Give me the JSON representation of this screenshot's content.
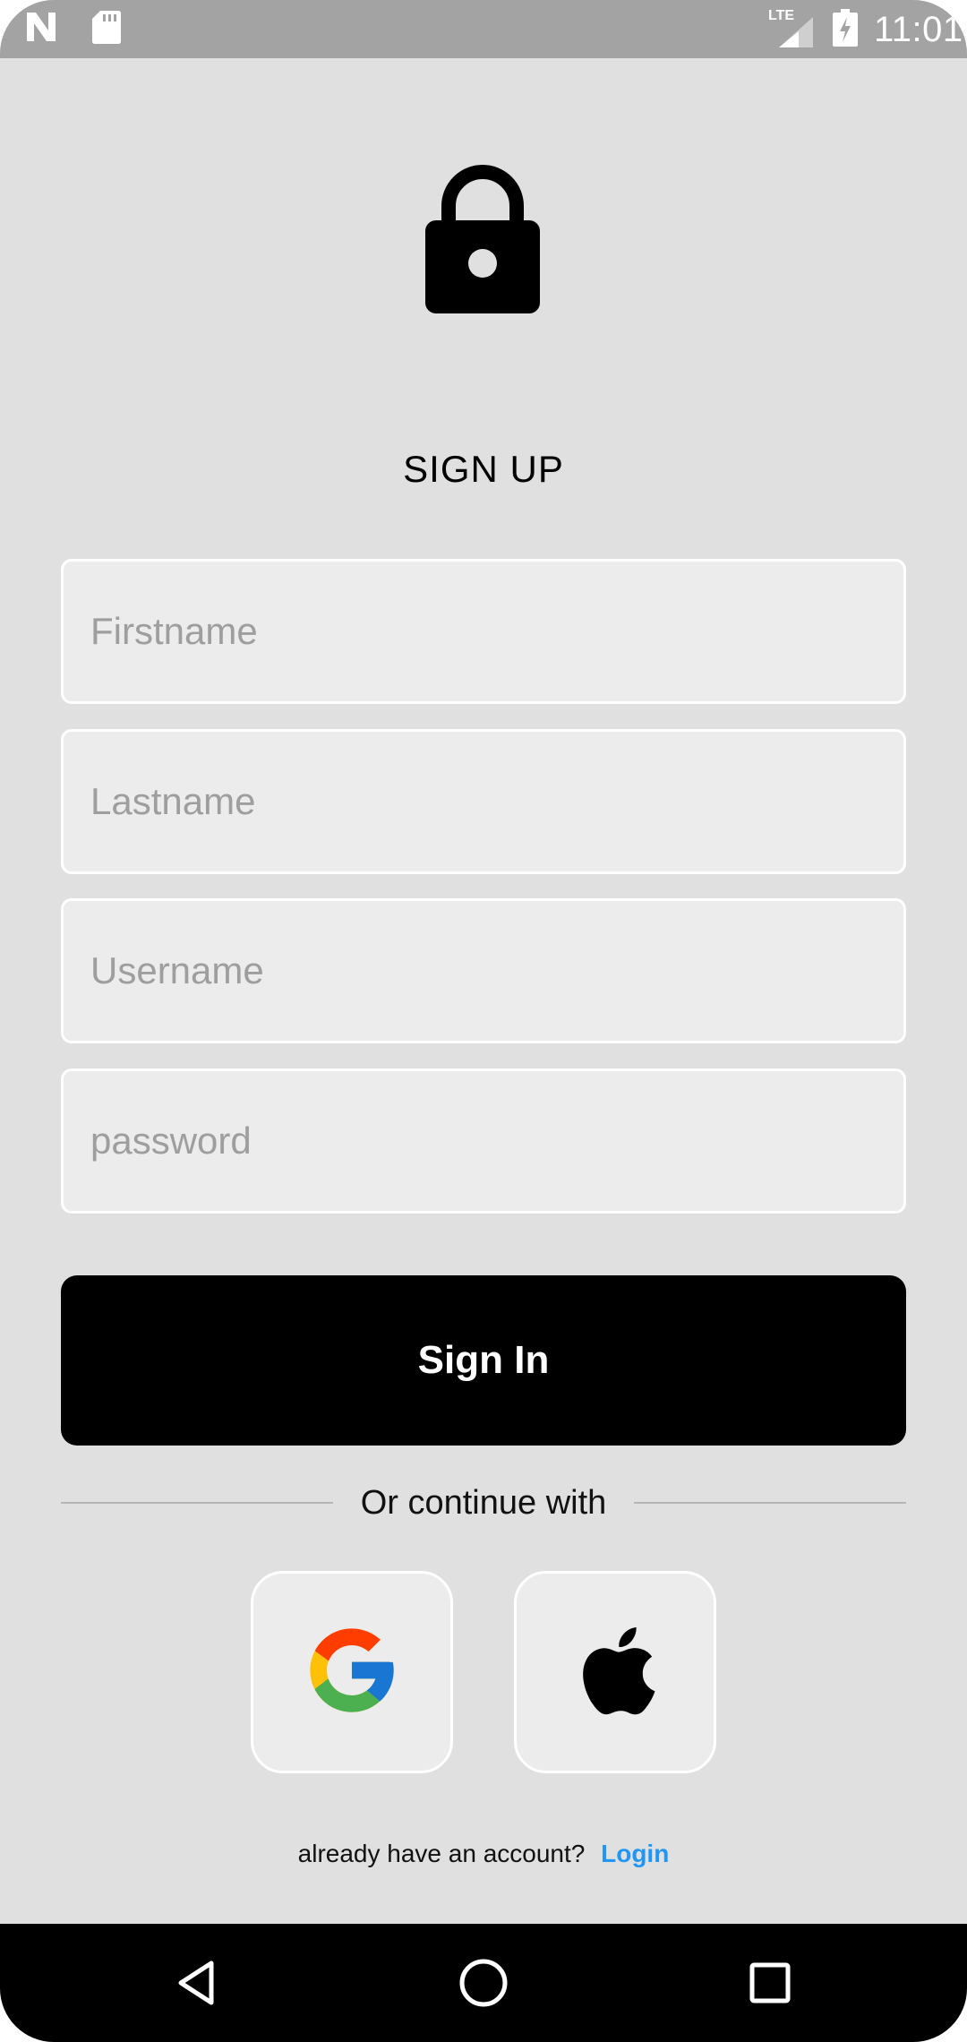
{
  "status_bar": {
    "time": "11:01",
    "network": "LTE",
    "icons": [
      "notification-n-icon",
      "sd-card-icon",
      "lte-signal-icon",
      "battery-charging-icon"
    ]
  },
  "header": {
    "icon": "lock-icon",
    "title": "SIGN UP"
  },
  "form": {
    "firstname_placeholder": "Firstname",
    "lastname_placeholder": "Lastname",
    "username_placeholder": "Username",
    "password_placeholder": "password",
    "firstname_value": "",
    "lastname_value": "",
    "username_value": "",
    "password_value": "",
    "submit_label": "Sign In"
  },
  "social": {
    "divider_text": "Or continue with",
    "providers": [
      {
        "name": "google",
        "icon": "google-icon"
      },
      {
        "name": "apple",
        "icon": "apple-icon"
      }
    ]
  },
  "footer": {
    "prompt": "already have an account?",
    "link_label": "Login",
    "link_color": "#2196f3"
  },
  "nav_bar": {
    "buttons": [
      "back-icon",
      "home-icon",
      "recents-icon"
    ]
  },
  "colors": {
    "background": "#e0e0e0",
    "input_fill": "#ececec",
    "button": "#000000",
    "status_bar": "#a3a3a3"
  }
}
